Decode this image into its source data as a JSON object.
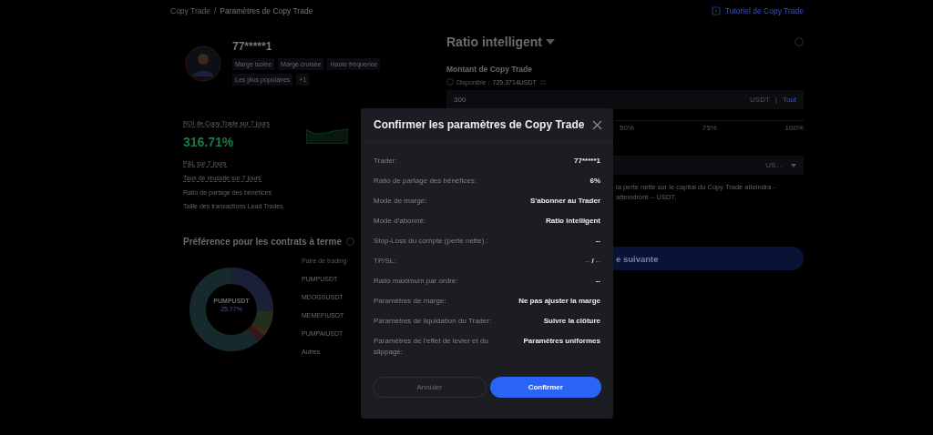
{
  "breadcrumb": {
    "parent": "Copy Trade",
    "separator": "/",
    "current": "Paramètres de Copy Trade"
  },
  "tutorial_link": "Tutoriel de Copy Trade",
  "trader": {
    "name": "77*****1",
    "tags": [
      "Marge isolée",
      "Marge croisée",
      "Haute fréquence",
      "Les plus populaires",
      "+1"
    ]
  },
  "stats": {
    "roi_label": "ROI de Copy Trade sur 7 jours",
    "roi_value": "316.71%",
    "items": [
      {
        "label": "P&L sur 7 jours",
        "underlined": true
      },
      {
        "label": "Taux de réussite sur 7 jours",
        "underlined": true
      },
      {
        "label": "Ratio de partage des bénéfices",
        "underlined": false
      },
      {
        "label": "Taille des transactions Lead Trades",
        "underlined": false
      }
    ]
  },
  "preference": {
    "title": "Préférence pour les contrats à terme",
    "center_label": "PUMPUSDT",
    "center_value": "25.77%",
    "legend_header": "Paire de trading",
    "pairs": [
      "PUMPUSDT",
      "MDOGSUSDT",
      "MEMEFIUSDT",
      "PUMPAIUSDT",
      "Autres"
    ]
  },
  "settings": {
    "mode": "Ratio intelligent",
    "amount_label": "Montant de Copy Trade",
    "available_label": "Disponible :",
    "available_value": "725.3714USDT",
    "amount_value": "300",
    "amount_unit": "USDT",
    "separator": "|",
    "all_button": "Tout",
    "slider_labels": [
      "50%",
      "75%",
      "100%"
    ],
    "unit_select": "US...",
    "note_lines": [
      "la perte nette sur le capital du Copy Trade atteindra -",
      "atteindront -- USDT."
    ],
    "next_button": "e suivante"
  },
  "dialog": {
    "title": "Confirmer les paramètres de Copy Trade",
    "rows": [
      {
        "kind": "text",
        "label": "Trader:",
        "value": "77*****1"
      },
      {
        "kind": "text",
        "label": "Ratio de partage des bénéfices:",
        "value": "6%"
      },
      {
        "kind": "text",
        "label": "Mode de marge:",
        "value": "S'abonner au Trader"
      },
      {
        "kind": "text",
        "label": "Mode d'abonné:",
        "value": "Ratio intelligent"
      },
      {
        "kind": "text",
        "label": "Stop-Loss du compte (perte nette) :",
        "value": "--"
      },
      {
        "kind": "split",
        "label": "TP/SL:",
        "tp": "--",
        "separator": "/",
        "sl": "--"
      },
      {
        "kind": "text",
        "label": "Ratio maximum par ordre:",
        "value": "--"
      },
      {
        "kind": "text",
        "label": "Paramètres de marge:",
        "value": "Ne pas ajuster la marge"
      },
      {
        "kind": "text",
        "label": "Paramètres de liquidation du Trader:",
        "value": "Suivre la clôture"
      },
      {
        "kind": "text",
        "label": "Paramètres de l'effet de levier et du slippage:",
        "value": "Paramètres uniformes"
      }
    ],
    "cancel_button": "Annuler",
    "confirm_button": "Confirmer"
  }
}
